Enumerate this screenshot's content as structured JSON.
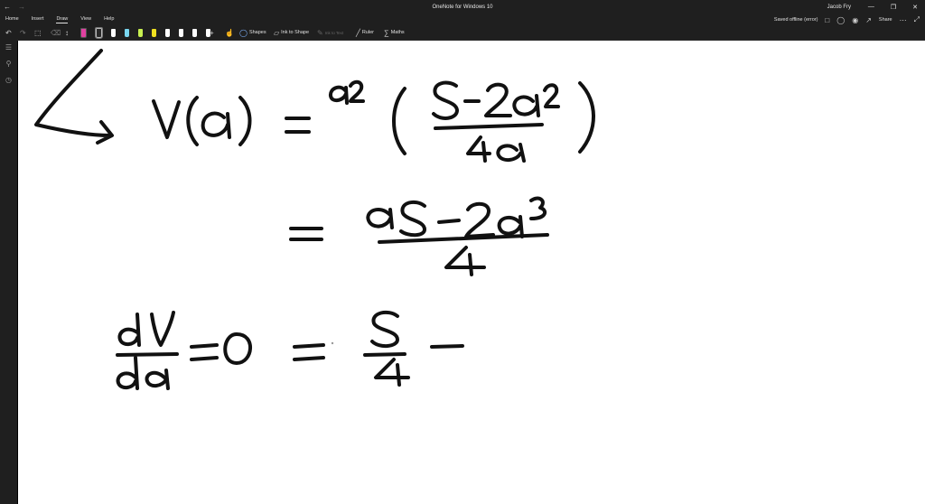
{
  "window": {
    "title": "OneNote for Windows 10",
    "user": "Jacob Fry",
    "nav_back": "←",
    "nav_forward": "→"
  },
  "menu": {
    "tabs": [
      "Home",
      "Insert",
      "Draw",
      "View",
      "Help"
    ],
    "active_tab": "Draw",
    "status": "Saved offline (error)",
    "share_label": "Share"
  },
  "toolbar": {
    "shapes_label": "Shapes",
    "ink_to_shape_label": "Ink to Shape",
    "ink_to_text_label": "Ink to Text",
    "ruler_label": "Ruler",
    "maths_label": "Maths",
    "pens": [
      {
        "color": "#e040a0"
      },
      {
        "color": "#2a2a2a"
      },
      {
        "color": "#ffffff"
      },
      {
        "color": "#7ad7f0"
      },
      {
        "color": "#c8f050"
      },
      {
        "color": "#f0e020"
      },
      {
        "color": "#ffffff"
      },
      {
        "color": "#ffffff"
      },
      {
        "color": "#ffffff"
      },
      {
        "color": "#ffffff"
      }
    ]
  },
  "sidebar": {
    "icons": [
      "notebooks-icon",
      "search-icon",
      "recent-icon"
    ]
  }
}
